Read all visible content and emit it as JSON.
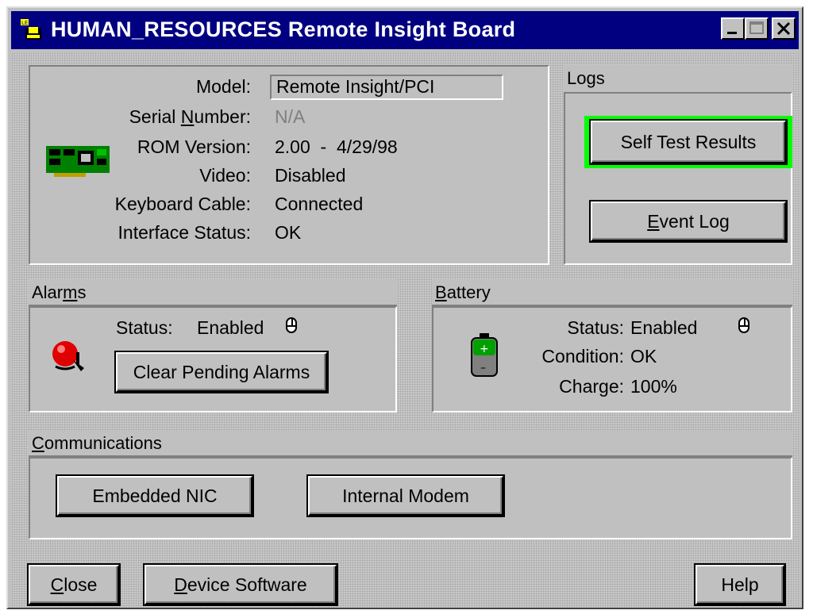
{
  "window": {
    "title": "HUMAN_RESOURCES Remote Insight Board",
    "controls": [
      "minimize",
      "maximize",
      "close"
    ]
  },
  "device_info": {
    "model_label": "Model:",
    "model_value": "Remote Insight/PCI",
    "serial_label_pre": "Serial ",
    "serial_label_ul": "N",
    "serial_label_post": "umber:",
    "serial_value": "N/A",
    "rom_label": "ROM Version:",
    "rom_value": "2.00  -  4/29/98",
    "video_label": "Video:",
    "video_value": "Disabled",
    "keyboard_label": "Keyboard Cable:",
    "keyboard_value": "Connected",
    "interface_label": "Interface Status:",
    "interface_value": "OK"
  },
  "logs": {
    "heading": "Logs",
    "self_test_label": "Self Test Results",
    "event_log_ul": "E",
    "event_log_rest": "vent Log"
  },
  "alarms": {
    "heading_pre": "Alar",
    "heading_ul": "m",
    "heading_post": "s",
    "status_label": "Status:",
    "status_value": "Enabled",
    "clear_button": "Clear Pending Alarms"
  },
  "battery": {
    "heading_ul": "B",
    "heading_rest": "attery",
    "status_label": "Status:",
    "status_value": "Enabled",
    "condition_label": "Condition:",
    "condition_value": "OK",
    "charge_label": "Charge:",
    "charge_value": "100%"
  },
  "communications": {
    "heading_ul": "C",
    "heading_rest": "ommunications",
    "nic_button": "Embedded NIC",
    "modem_button": "Internal Modem"
  },
  "footer": {
    "close_ul": "C",
    "close_rest": "lose",
    "device_ul": "D",
    "device_rest": "evice Software",
    "help_label": "Help"
  },
  "colors": {
    "titlebar": "#000080",
    "focus_ring": "#00ff00",
    "disabled_text": "#808080",
    "alarm_bell": "#e00000",
    "battery": "#00a000"
  }
}
